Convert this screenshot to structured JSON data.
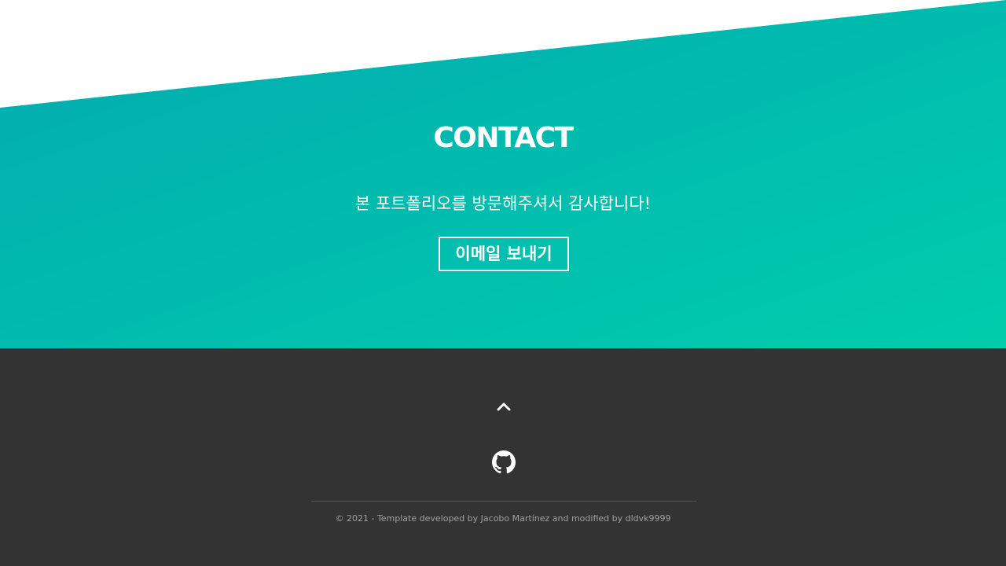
{
  "contact": {
    "title": "CONTACT",
    "message": "본 포트폴리오를 방문해주셔서 감사합니다!",
    "email_button_label": "이메일 보내기"
  },
  "footer": {
    "back_to_top_icon": "chevron-up-icon",
    "github_icon": "github-icon",
    "copyright": "© 2021 - Template developed by Jacobo Martínez and modified by dldvk9999"
  },
  "colors": {
    "gradient_start": "#02aab0",
    "gradient_end": "#00cdac",
    "footer_background": "#333333",
    "text_white": "#ffffff",
    "copyright_text": "#a0a0a0"
  }
}
